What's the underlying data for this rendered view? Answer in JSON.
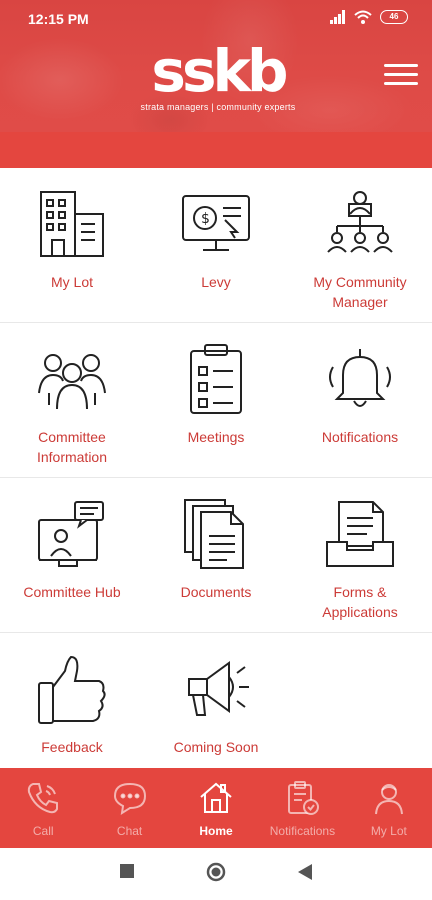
{
  "status": {
    "time": "12:15 PM",
    "battery": "46"
  },
  "header": {
    "logo": "sskb",
    "tagline": "strata managers | community experts"
  },
  "tiles": [
    {
      "label": "My Lot",
      "icon": "building-icon"
    },
    {
      "label": "Levy",
      "icon": "levy-payment-icon"
    },
    {
      "label": "My Community Manager",
      "icon": "org-chart-icon"
    },
    {
      "label": "Committee Information",
      "icon": "people-group-icon"
    },
    {
      "label": "Meetings",
      "icon": "clipboard-checklist-icon"
    },
    {
      "label": "Notifications",
      "icon": "bell-icon"
    },
    {
      "label": "Committee Hub",
      "icon": "video-chat-icon"
    },
    {
      "label": "Documents",
      "icon": "documents-icon"
    },
    {
      "label": "Forms & Applications",
      "icon": "inbox-tray-icon"
    },
    {
      "label": "Feedback",
      "icon": "thumbs-up-icon"
    },
    {
      "label": "Coming Soon",
      "icon": "megaphone-icon"
    }
  ],
  "bottom_nav": [
    {
      "label": "Call",
      "icon": "phone-icon",
      "active": false
    },
    {
      "label": "Chat",
      "icon": "chat-icon",
      "active": false
    },
    {
      "label": "Home",
      "icon": "home-icon",
      "active": true
    },
    {
      "label": "Notifications",
      "icon": "notification-doc-icon",
      "active": false
    },
    {
      "label": "My Lot",
      "icon": "user-icon",
      "active": false
    }
  ],
  "colors": {
    "brand_red": "#e4463f",
    "label_red": "#cc3b37",
    "icon_stroke": "#222222"
  }
}
